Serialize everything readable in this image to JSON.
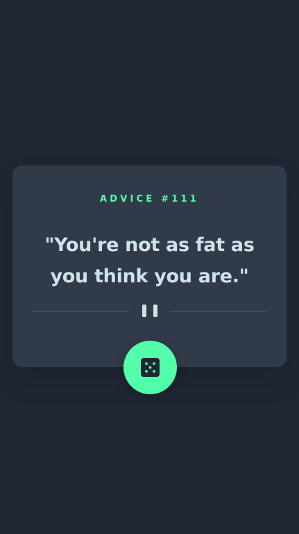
{
  "card": {
    "advice_label": "ADVICE #111",
    "quote": "\"You're not as fat as you think you are.\""
  },
  "icons": {
    "divider": "pause-icon",
    "button": "dice-icon"
  },
  "colors": {
    "background": "#202733",
    "card": "#313a48",
    "accent": "#53ffaa",
    "text": "#cee3e9",
    "divider": "#4f5d74"
  }
}
